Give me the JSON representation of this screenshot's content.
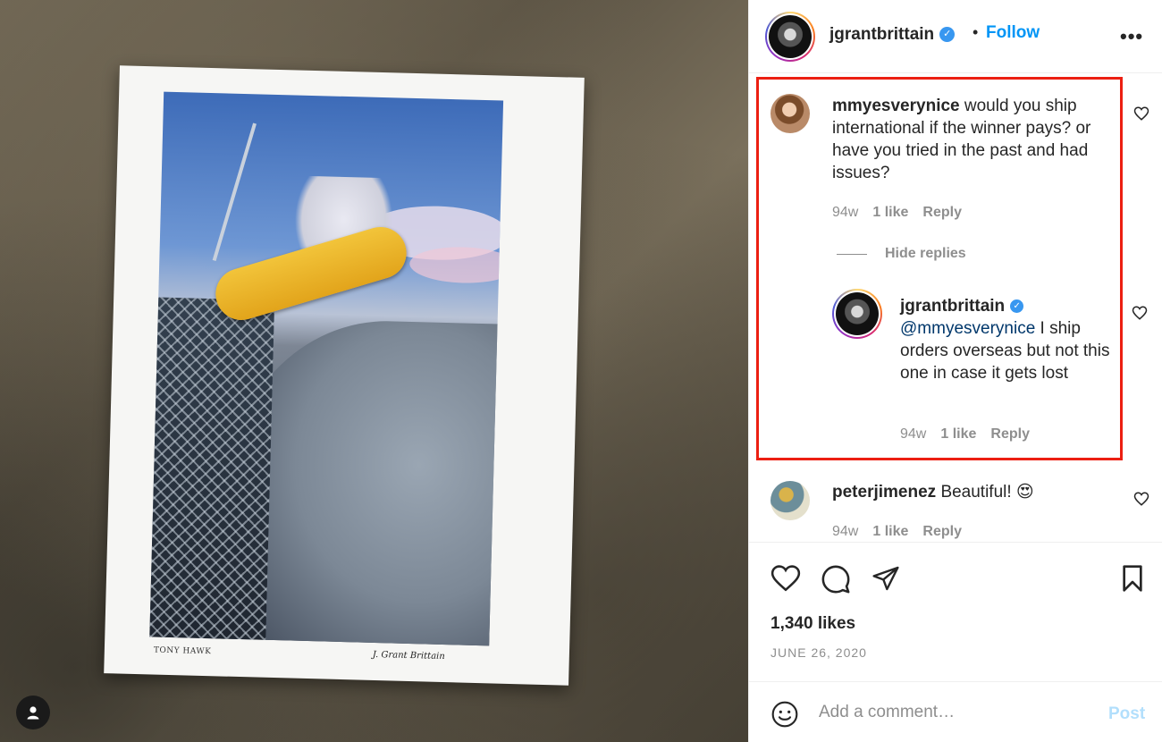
{
  "photo": {
    "print_caption_left": "TONY HAWK",
    "print_signature": "J. Grant Brittain",
    "user_tag_icon": "person-icon"
  },
  "header": {
    "username": "jgrantbrittain",
    "verified_icon": "verified-badge-icon",
    "separator": "•",
    "follow_label": "Follow",
    "more_icon": "more-horizontal-icon",
    "more_glyph": "•••"
  },
  "comments": [
    {
      "username": "mmyesverynice",
      "text": "would you ship international if the winner pays? or have you tried in the past and had issues?",
      "time": "94w",
      "likes": "1 like",
      "reply_label": "Reply"
    },
    {
      "username": "peterjimenez",
      "text": "Beautiful! 😍",
      "time": "94w",
      "likes": "1 like",
      "reply_label": "Reply"
    }
  ],
  "replies_toggle": "Hide replies",
  "reply": {
    "username": "jgrantbrittain",
    "mention": "@mmyesverynice",
    "text": " I ship orders overseas but not this one in case it gets lost",
    "time": "94w",
    "likes": "1 like",
    "reply_label": "Reply"
  },
  "actions": {
    "like_icon": "heart-icon",
    "comment_icon": "comment-icon",
    "share_icon": "paper-plane-icon",
    "save_icon": "bookmark-icon"
  },
  "likes_count": "1,340 likes",
  "post_date": "JUNE 26, 2020",
  "add_comment": {
    "emoji_icon": "emoji-icon",
    "placeholder": "Add a comment…",
    "post_label": "Post"
  },
  "colors": {
    "follow_blue": "#0095f6",
    "highlight_red": "#ec1f12",
    "post_disabled": "#b2dffc",
    "muted_gray": "#8e8e8e"
  }
}
